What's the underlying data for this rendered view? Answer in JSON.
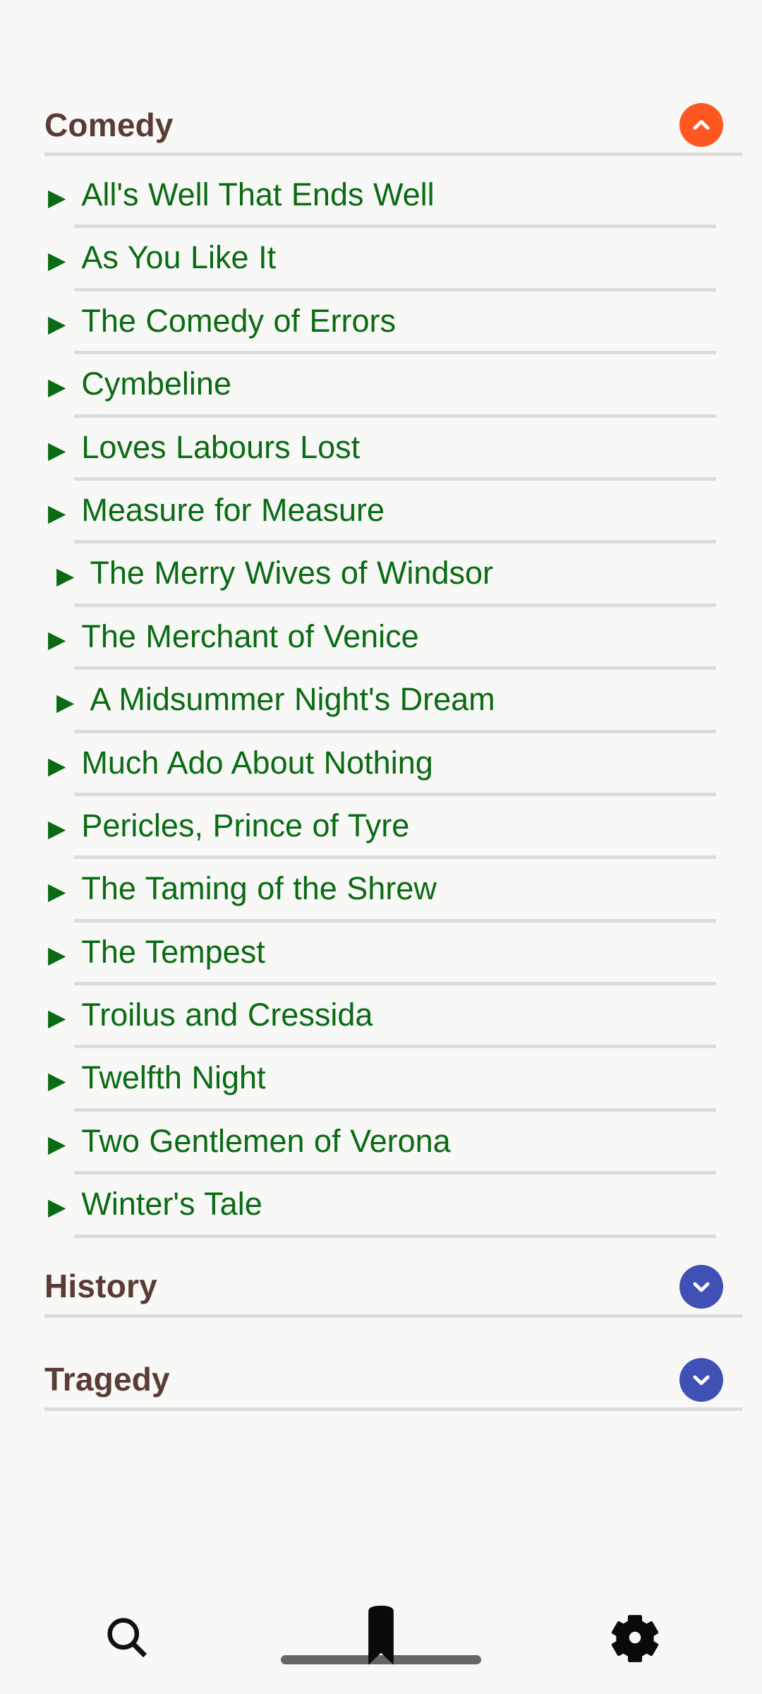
{
  "app": {
    "background_color": "#f8f8f7",
    "header_text_color": "#5a3c34",
    "link_text_color": "#0a6b13",
    "divider_color": "#dcdcdc",
    "collapse_accent_color": "#ff5722",
    "expand_accent_color": "#3f51b5"
  },
  "sections": [
    {
      "title": "Comedy",
      "expanded": true,
      "toggle_icon": "chevron-up-icon",
      "toggle_color": "#ff5722",
      "items": [
        {
          "bullet": "▶",
          "title": "All's Well That Ends Well"
        },
        {
          "bullet": "▶",
          "title": "As You Like It"
        },
        {
          "bullet": "▶",
          "title": "The Comedy of Errors"
        },
        {
          "bullet": "▶",
          "title": "Cymbeline"
        },
        {
          "bullet": "▶",
          "title": "Loves Labours Lost"
        },
        {
          "bullet": "▶",
          "title": "Measure for Measure"
        },
        {
          "bullet": "▶",
          "title": "The Merry Wives of Windsor"
        },
        {
          "bullet": "▶",
          "title": "The Merchant of Venice"
        },
        {
          "bullet": "▶",
          "title": "A Midsummer Night's Dream"
        },
        {
          "bullet": "▶",
          "title": "Much Ado About Nothing"
        },
        {
          "bullet": "▶",
          "title": "Pericles, Prince of Tyre"
        },
        {
          "bullet": "▶",
          "title": "The Taming of the Shrew"
        },
        {
          "bullet": "▶",
          "title": "The Tempest"
        },
        {
          "bullet": "▶",
          "title": "Troilus and Cressida"
        },
        {
          "bullet": "▶",
          "title": "Twelfth Night"
        },
        {
          "bullet": "▶",
          "title": "Two Gentlemen of Verona"
        },
        {
          "bullet": "▶",
          "title": "Winter's Tale"
        }
      ]
    },
    {
      "title": "History",
      "expanded": false,
      "toggle_icon": "chevron-down-icon",
      "toggle_color": "#3f51b5",
      "items": []
    },
    {
      "title": "Tragedy",
      "expanded": false,
      "toggle_icon": "chevron-down-icon",
      "toggle_color": "#3f51b5",
      "items": []
    }
  ],
  "bottom_nav": {
    "items": [
      {
        "icon": "search-icon",
        "label": ""
      },
      {
        "icon": "bookmark-icon",
        "label": ""
      },
      {
        "icon": "gear-icon",
        "label": ""
      }
    ]
  }
}
